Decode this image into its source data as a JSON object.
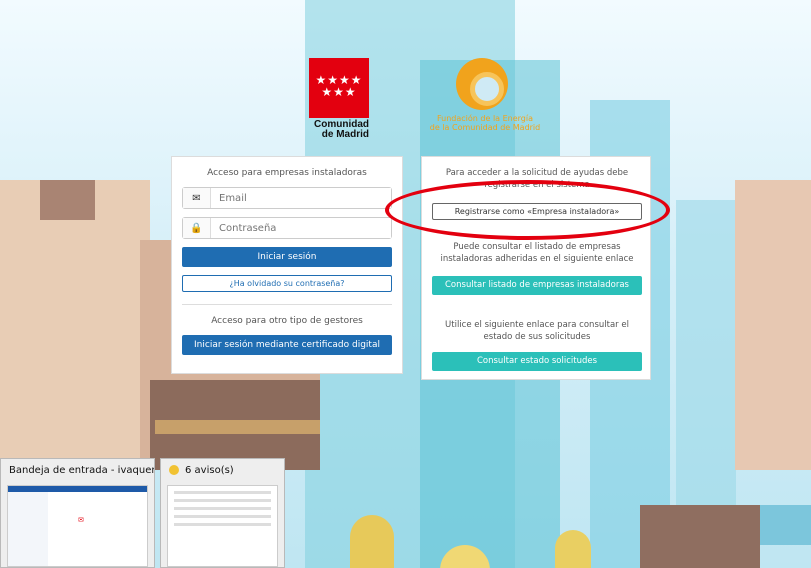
{
  "branding": {
    "cam_stars": "★★★★\n★★★",
    "cam_name": "Comunidad\nde Madrid",
    "foundation_name": "Fundación de la Energía\nde la Comunidad de Madrid"
  },
  "login_panel": {
    "title": "Acceso para empresas instaladoras",
    "email_placeholder": "Email",
    "password_placeholder": "Contraseña",
    "login_button": "Iniciar sesión",
    "forgot_password": "¿Ha olvidado su contraseña?",
    "other_title": "Acceso para otro tipo de gestores",
    "certificate_button": "Iniciar sesión mediante certificado digital"
  },
  "info_panel": {
    "register_text": "Para acceder a la solicitud de ayudas debe registrarse en el sistema",
    "register_button": "Registrarse como «Empresa instaladora»",
    "list_text": "Puede consultar el listado de empresas instaladoras adheridas en el siguiente enlace",
    "list_button": "Consultar listado de empresas instaladoras",
    "status_text": "Utilice el siguiente enlace para consultar el estado de sus solicitudes",
    "status_button": "Consultar estado solicitudes"
  },
  "taskbar_previews": [
    {
      "title": "Bandeja de entrada - ivaquero..."
    },
    {
      "title": "6 aviso(s)"
    }
  ],
  "colors": {
    "primary": "#1f6db2",
    "teal": "#2bc0b9",
    "annotation": "#e3000f",
    "brand_red": "#e3000f",
    "foundation_orange": "#f1a31c"
  }
}
